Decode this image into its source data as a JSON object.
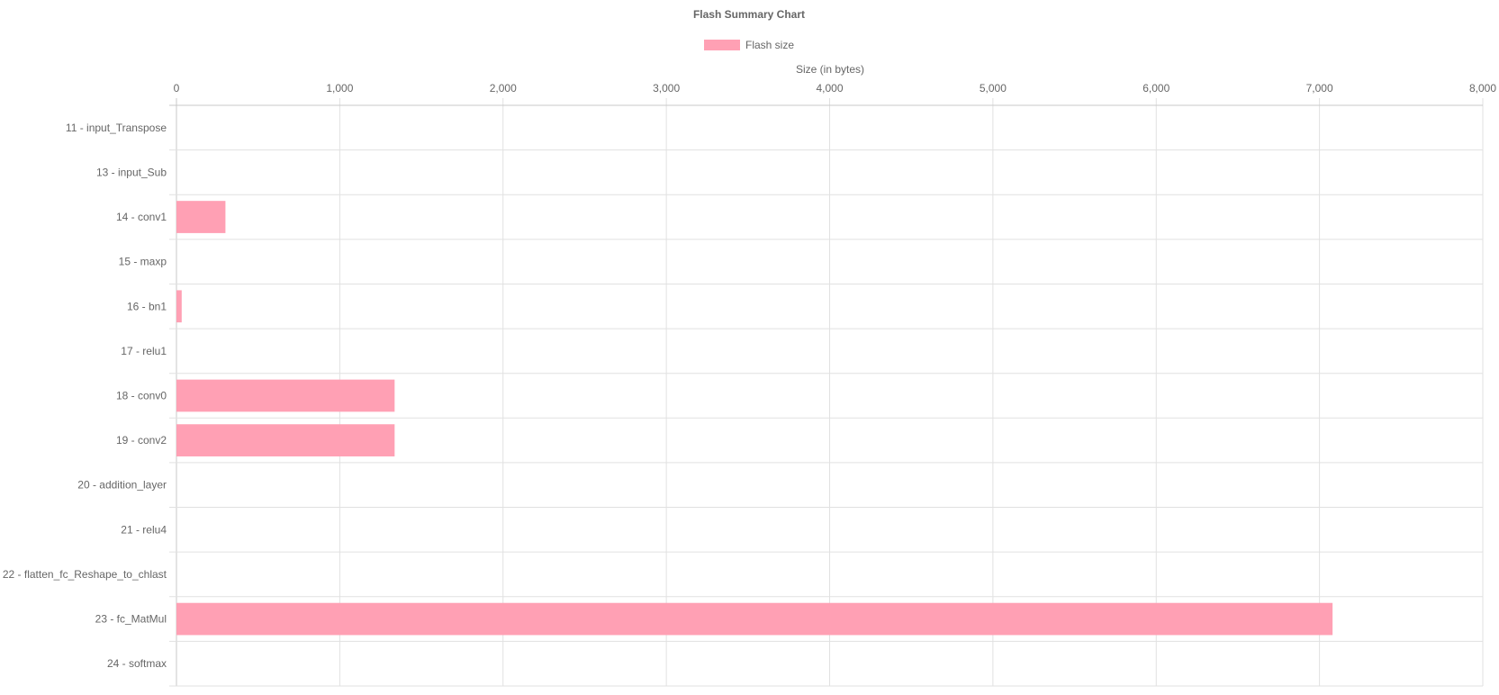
{
  "chart_data": {
    "type": "bar",
    "orientation": "horizontal",
    "title": "Flash Summary Chart",
    "xlabel": "Size (in bytes)",
    "ylabel": "",
    "xlim": [
      0,
      8000
    ],
    "x_ticks": [
      "0",
      "1,000",
      "2,000",
      "3,000",
      "4,000",
      "5,000",
      "6,000",
      "7,000",
      "8,000"
    ],
    "grid": true,
    "legend_position": "top",
    "categories": [
      "11 - input_Transpose",
      "13 - input_Sub",
      "14 - conv1",
      "15 - maxp",
      "16 - bn1",
      "17 - relu1",
      "18 - conv0",
      "19 - conv2",
      "20 - addition_layer",
      "21 - relu4",
      "22 - flatten_fc_Reshape_to_chlast",
      "23 - fc_MatMul",
      "24 - softmax"
    ],
    "series": [
      {
        "name": "Flash size",
        "color": "#ffa0b4",
        "values": [
          0,
          0,
          300,
          0,
          32,
          0,
          1336,
          1336,
          0,
          0,
          0,
          7080,
          0
        ]
      }
    ]
  }
}
